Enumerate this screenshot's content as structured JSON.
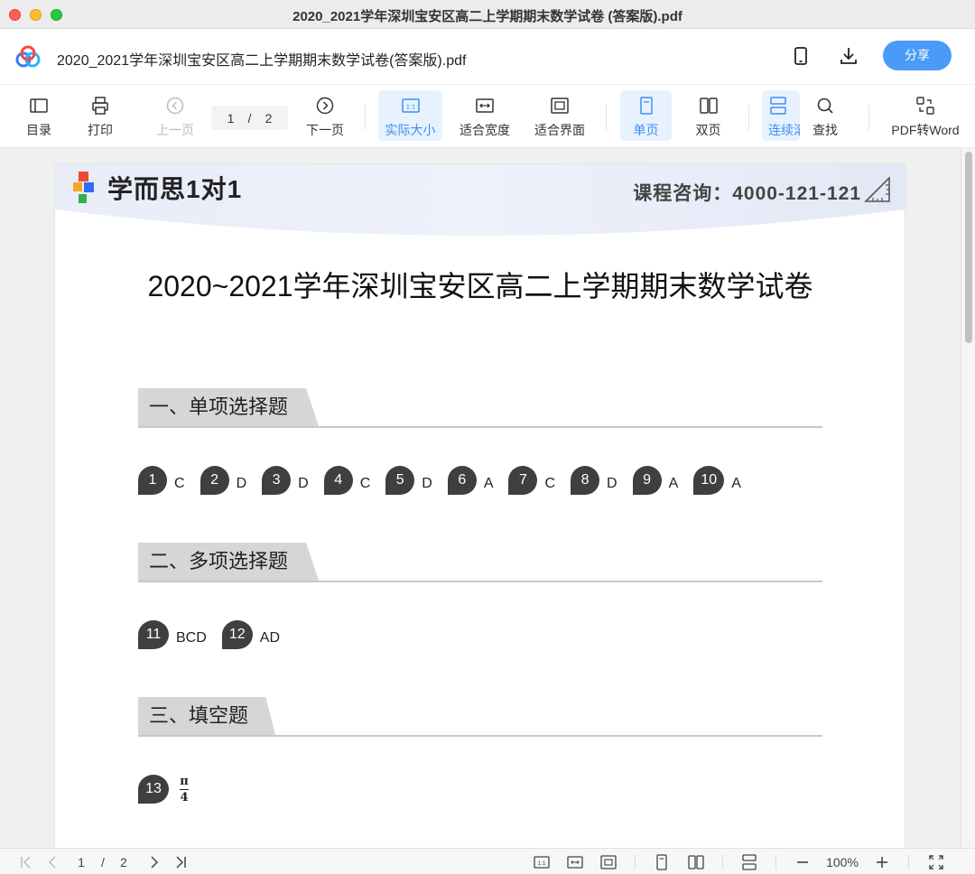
{
  "window": {
    "title": "2020_2021学年深圳宝安区高二上学期期末数学试卷 (答案版).pdf"
  },
  "header": {
    "doc_name": "2020_2021学年深圳宝安区高二上学期期末数学试卷(答案版).pdf",
    "share_label": "分享",
    "icons": [
      "app-logo-icon",
      "phone-icon",
      "download-icon"
    ]
  },
  "toolbar": {
    "catalog": "目录",
    "print": "打印",
    "prev_page": "上一页",
    "page_current": "1",
    "page_sep": "/",
    "page_total": "2",
    "next_page": "下一页",
    "actual_size": "实际大小",
    "fit_width": "适合宽度",
    "fit_page": "适合界面",
    "single_page": "单页",
    "double_page": "双页",
    "continuous": "连续滚",
    "search": "查找",
    "pdf_to_word": "PDF转Word",
    "actual_size_glyph": "1:1"
  },
  "document": {
    "brand": "学而思1对1",
    "hotline": "课程咨询：4000-121-121",
    "title": "2020~2021学年深圳宝安区高二上学期期末数学试卷",
    "sections": [
      {
        "heading": "一、单项选择题",
        "answers": [
          {
            "num": "1",
            "ans": "C"
          },
          {
            "num": "2",
            "ans": "D"
          },
          {
            "num": "3",
            "ans": "D"
          },
          {
            "num": "4",
            "ans": "C"
          },
          {
            "num": "5",
            "ans": "D"
          },
          {
            "num": "6",
            "ans": "A"
          },
          {
            "num": "7",
            "ans": "C"
          },
          {
            "num": "8",
            "ans": "D"
          },
          {
            "num": "9",
            "ans": "A"
          },
          {
            "num": "10",
            "ans": "A"
          }
        ]
      },
      {
        "heading": "二、多项选择题",
        "answers": [
          {
            "num": "11",
            "ans": "BCD"
          },
          {
            "num": "12",
            "ans": "AD"
          }
        ]
      },
      {
        "heading": "三、填空题",
        "answers": [
          {
            "num": "13",
            "numerator": "π",
            "denominator": "4"
          }
        ]
      }
    ]
  },
  "statusbar": {
    "page_current": "1",
    "page_sep": "/",
    "page_total": "2",
    "zoom": "100%",
    "actual_size_glyph": "1:1"
  },
  "colors": {
    "accent": "#4a9bf7",
    "active_bg": "#e8f2fe",
    "bubble": "#3f3f3f",
    "section_tab": "#d6d6d6"
  }
}
